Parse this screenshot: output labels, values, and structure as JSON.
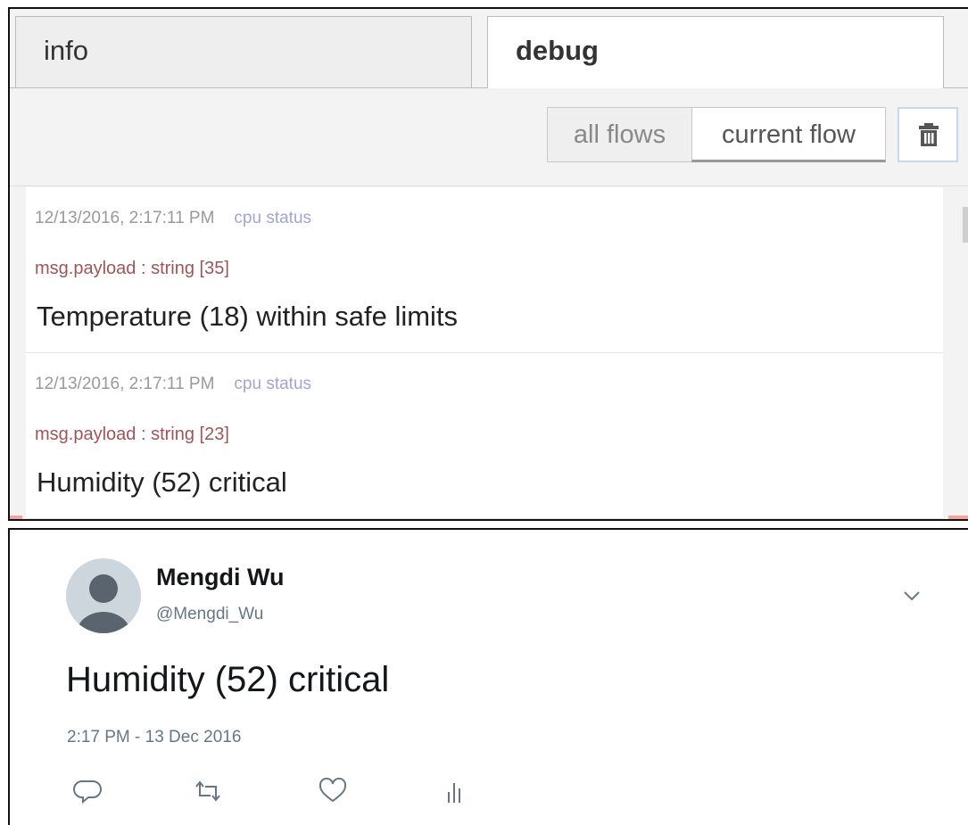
{
  "debug_panel": {
    "tabs": [
      {
        "label": "info",
        "active": false
      },
      {
        "label": "debug",
        "active": true
      }
    ],
    "filter_buttons": {
      "all_flows": "all flows",
      "current_flow": "current flow"
    },
    "trash_icon": "trash-icon",
    "messages": [
      {
        "timestamp": "12/13/2016, 2:17:11 PM",
        "node": "cpu status",
        "type": "msg.payload : string [35]",
        "value": "Temperature (18) within safe limits"
      },
      {
        "timestamp": "12/13/2016, 2:17:11 PM",
        "node": "cpu status",
        "type": "msg.payload : string [23]",
        "value": "Humidity (52) critical"
      }
    ]
  },
  "tweet": {
    "author_name": "Mengdi Wu",
    "author_handle": "@Mengdi_Wu",
    "text": "Humidity (52) critical",
    "time": "2:17 PM - 13 Dec 2016",
    "actions": [
      "reply-icon",
      "retweet-icon",
      "like-icon",
      "analytics-icon"
    ]
  },
  "colors": {
    "node_name": "#a0a6d0",
    "msg_type": "#a05555",
    "handle": "#657786",
    "panel_bg": "#f3f3f3"
  }
}
